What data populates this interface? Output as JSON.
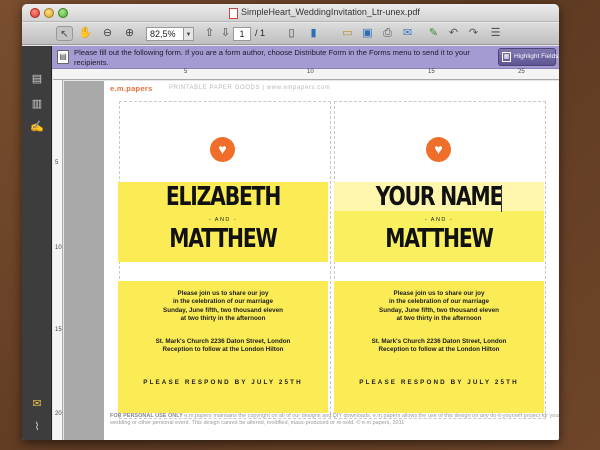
{
  "window": {
    "title": "SimpleHeart_WeddingInvitation_Ltr-unex.pdf"
  },
  "toolbar": {
    "zoom_value": "82,5%",
    "page_current": "1",
    "page_total": "/ 1"
  },
  "form_bar": {
    "message": "Please fill out the following form. If you are a form author, choose Distribute Form in the Forms menu to send it to your recipients.",
    "highlight_label": "Highlight Fields"
  },
  "rulers": {
    "top": [
      "5",
      "10",
      "15",
      "25"
    ],
    "left": [
      "5",
      "10",
      "15",
      "20"
    ]
  },
  "page": {
    "brand": "e.m.papers",
    "tagline": "PRINTABLE PAPER GOODS | www.empapers.com",
    "footer_label": "FOR PERSONAL USE ONLY",
    "footer_text": "e.m.papers maintains the copyright on all of our designs and DIY downloads. e.m.papers allows the use of this design on any do-it-yourself project for your wedding or other personal event. This design cannot be altered, modified, mass-produced or re-sold. © e.m.papers, 2011"
  },
  "card_left": {
    "name1": "ELIZABETH",
    "and": "- AND -",
    "name2": "MATTHEW",
    "detail1": "Please join us  to share our joy\nin the celebration of our marriage\nSunday, June fifth, two thousand eleven\nat two thirty in the afternoon",
    "detail2": "St. Mark's Church 2236 Daton Street, London\nReception to follow at the London Hilton",
    "rsvp": "PLEASE RESPOND BY JULY 25TH"
  },
  "card_right": {
    "name1": "YOUR NAME",
    "and": "- AND -",
    "name2": "MATTHEW",
    "detail1": "Please join us  to share our joy\nin the celebration of our marriage\nSunday, June fifth, two thousand eleven\nat two thirty in the afternoon",
    "detail2": "St. Mark's Church 2236 Daton Street, London\nReception to follow at the London Hilton",
    "rsvp": "PLEASE RESPOND BY JULY 25TH"
  },
  "colors": {
    "accent_yellow": "#fbec55",
    "heart_orange": "#ee6e2a",
    "form_bar": "#a59bd3",
    "brand_orange": "#e8703a"
  }
}
